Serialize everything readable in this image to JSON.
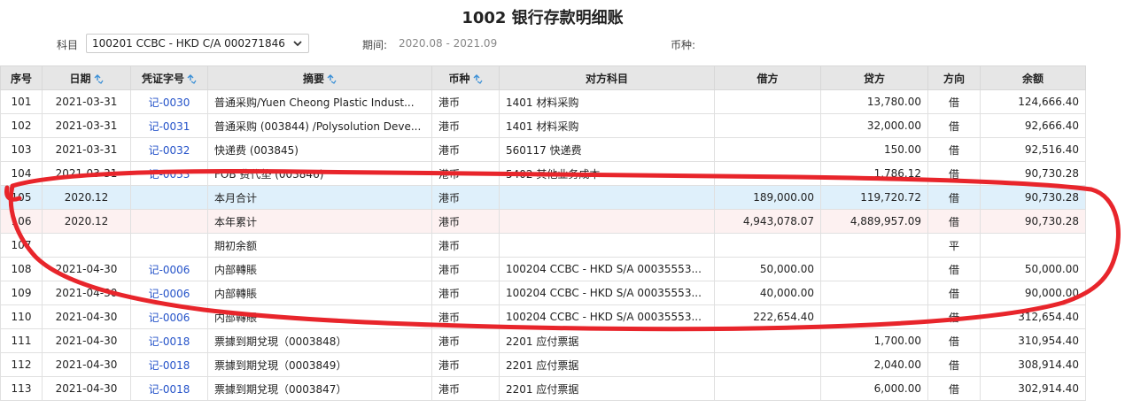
{
  "title": "1002 银行存款明细账",
  "filters": {
    "subject_label": "科目",
    "subject_value": "100201 CCBC - HKD C/A 000271846",
    "period_label": "期间:",
    "period_value": "2020.08 - 2021.09",
    "currency_label": "币种:"
  },
  "table": {
    "headers": [
      "序号",
      "日期",
      "凭证字号",
      "摘要",
      "币种",
      "对方科目",
      "借方",
      "贷方",
      "方向",
      "余额"
    ],
    "rows": [
      {
        "seq": "101",
        "date": "2021-03-31",
        "voucher": "记-0030",
        "summary": "普通采购/Yuen Cheong Plastic Indust...",
        "currency": "港币",
        "counter": "1401 材料采购",
        "debit": "",
        "credit": "13,780.00",
        "dir": "借",
        "balance": "124,666.40"
      },
      {
        "seq": "102",
        "date": "2021-03-31",
        "voucher": "记-0031",
        "summary": "普通采购 (003844) /Polysolution Deve...",
        "currency": "港币",
        "counter": "1401 材料采购",
        "debit": "",
        "credit": "32,000.00",
        "dir": "借",
        "balance": "92,666.40"
      },
      {
        "seq": "103",
        "date": "2021-03-31",
        "voucher": "记-0032",
        "summary": "快递费 (003845)",
        "currency": "港币",
        "counter": "560117 快递费",
        "debit": "",
        "credit": "150.00",
        "dir": "借",
        "balance": "92,516.40"
      },
      {
        "seq": "104",
        "date": "2021-03-31",
        "voucher": "记-0033",
        "summary": "FOB 费代垫 (003846)",
        "currency": "港币",
        "counter": "5402 其他业务成本",
        "debit": "",
        "credit": "1,786.12",
        "dir": "借",
        "balance": "90,730.28"
      },
      {
        "seq": "105",
        "date": "2020.12",
        "voucher": "",
        "summary": "本月合计",
        "currency": "港币",
        "counter": "",
        "debit": "189,000.00",
        "credit": "119,720.72",
        "dir": "借",
        "balance": "90,730.28"
      },
      {
        "seq": "106",
        "date": "2020.12",
        "voucher": "",
        "summary": "本年累计",
        "currency": "港币",
        "counter": "",
        "debit": "4,943,078.07",
        "credit": "4,889,957.09",
        "dir": "借",
        "balance": "90,730.28"
      },
      {
        "seq": "107",
        "date": "",
        "voucher": "",
        "summary": "期初余额",
        "currency": "港币",
        "counter": "",
        "debit": "",
        "credit": "",
        "dir": "平",
        "balance": ""
      },
      {
        "seq": "108",
        "date": "2021-04-30",
        "voucher": "记-0006",
        "summary": "内部轉賬",
        "currency": "港币",
        "counter": "100204 CCBC - HKD S/A 00035553...",
        "debit": "50,000.00",
        "credit": "",
        "dir": "借",
        "balance": "50,000.00"
      },
      {
        "seq": "109",
        "date": "2021-04-30",
        "voucher": "记-0006",
        "summary": "内部轉賬",
        "currency": "港币",
        "counter": "100204 CCBC - HKD S/A 00035553...",
        "debit": "40,000.00",
        "credit": "",
        "dir": "借",
        "balance": "90,000.00"
      },
      {
        "seq": "110",
        "date": "2021-04-30",
        "voucher": "记-0006",
        "summary": "内部轉賬",
        "currency": "港币",
        "counter": "100204 CCBC - HKD S/A 00035553...",
        "debit": "222,654.40",
        "credit": "",
        "dir": "借",
        "balance": "312,654.40"
      },
      {
        "seq": "111",
        "date": "2021-04-30",
        "voucher": "记-0018",
        "summary": "票據到期兌現（0003848）",
        "currency": "港币",
        "counter": "2201 应付票据",
        "debit": "",
        "credit": "1,700.00",
        "dir": "借",
        "balance": "310,954.40"
      },
      {
        "seq": "112",
        "date": "2021-04-30",
        "voucher": "记-0018",
        "summary": "票據到期兌現（0003849）",
        "currency": "港币",
        "counter": "2201 应付票据",
        "debit": "",
        "credit": "2,040.00",
        "dir": "借",
        "balance": "308,914.40"
      },
      {
        "seq": "113",
        "date": "2021-04-30",
        "voucher": "记-0018",
        "summary": "票據到期兌現（0003847）",
        "currency": "港币",
        "counter": "2201 应付票据",
        "debit": "",
        "credit": "6,000.00",
        "dir": "借",
        "balance": "302,914.40"
      }
    ]
  },
  "colors": {
    "link": "#2553c9",
    "highlight_blue": "#dff0fb",
    "highlight_pink": "#fdf1f1",
    "annotation_red": "#e8252b",
    "sort_icon": "#3a8fd6"
  },
  "icons": {
    "sort": "sort-arrows-icon",
    "dropdown": "chevron-down-icon"
  }
}
